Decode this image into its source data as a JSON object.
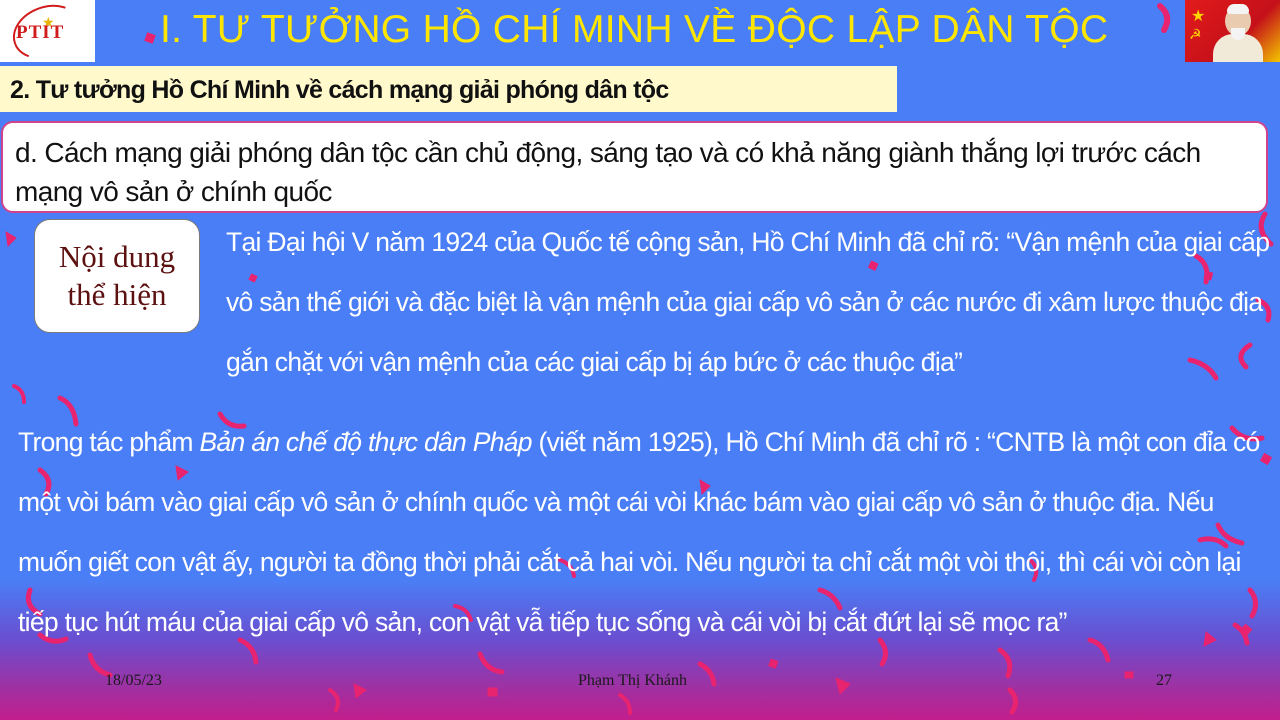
{
  "logo": {
    "text": "PTIT"
  },
  "title": "I. TƯ TƯỞNG HỒ CHÍ MINH VỀ ĐỘC LẬP DÂN TỘC",
  "subheading": "2. Tư tưởng Hồ Chí Minh về cách mạng giải phóng dân tộc",
  "section_heading": "d. Cách mạng giải phóng dân tộc cần chủ động, sáng tạo và có khả năng giành thắng lợi trước cách mạng vô sản ở chính quốc",
  "label": {
    "line1": "Nội dung",
    "line2": "thể hiện"
  },
  "paragraph1": "Tại Đại hội V năm 1924 của Quốc tế cộng sản, Hồ Chí Minh đã chỉ rõ: “Vận mệnh của giai cấp vô sản thế giới và đặc biệt là vận mệnh của giai cấp vô sản ở các nước đi xâm lược thuộc địa gắn chặt với vận mệnh của các giai cấp bị áp bức ở các thuộc địa”",
  "paragraph2": {
    "prefix": "Trong tác phẩm ",
    "work_title": "Bản án chế độ thực dân Pháp",
    "rest": " (viết năm 1925), Hồ Chí Minh đã chỉ rõ : “CNTB là một con đỉa có một vòi bám vào giai cấp vô sản ở chính quốc và một cái vòi khác bám vào giai cấp vô sản ở thuộc địa. Nếu muốn giết con vật ấy, người ta đồng thời phải cắt cả hai vòi. Nếu người ta chỉ cắt một vòi thôi, thì cái vòi còn lại tiếp tục hút máu của giai cấp vô sản, con vật vẫ tiếp tục sống và cái vòi bị cắt đứt lại sẽ mọc ra”"
  },
  "footer": {
    "date": "18/05/23",
    "author": "Phạm Thị Khánh",
    "page": "27"
  },
  "colors": {
    "background": "#4a7ef6",
    "title": "#ffe600",
    "confetti": "#e8236f",
    "subheading_bg": "#fff9cc"
  }
}
